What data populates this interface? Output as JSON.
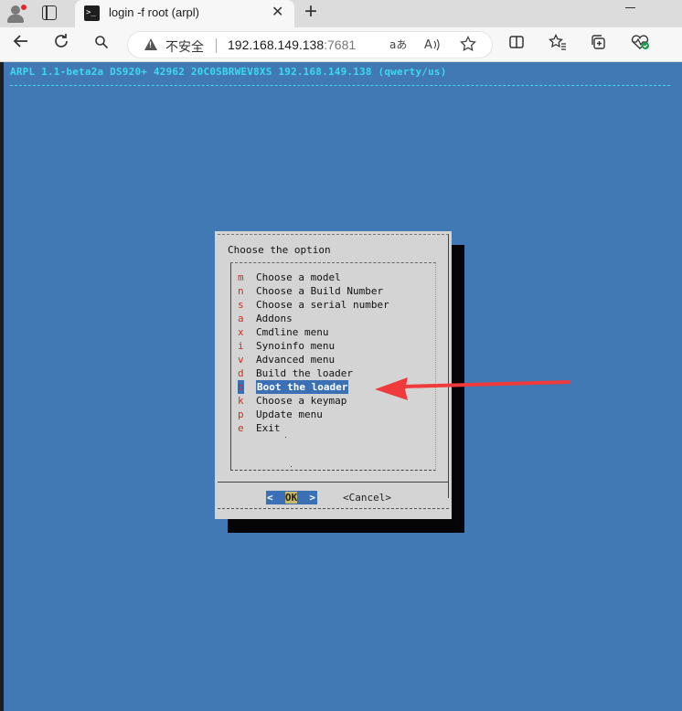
{
  "browser": {
    "tab_title": "login -f root (arpl)",
    "tab_icon_glyph": ">_",
    "close_glyph": "✕",
    "new_tab_glyph": "+",
    "address": {
      "security_label": "不安全",
      "host": "192.168.149.138",
      "port": ":7681"
    },
    "icons": [
      "profile-icon",
      "tab-actions-icon",
      "back-icon",
      "reload-icon",
      "search-icon",
      "read-aloud-icon",
      "text-size-icon",
      "favorite-icon",
      "split-screen-icon",
      "favorites-icon",
      "collections-icon",
      "performance-icon"
    ]
  },
  "terminal": {
    "backtitle": "ARPL 1.1-beta2a DS920+ 42962 20C0SBRWEV8XS 192.168.149.138 (qwerty/us)",
    "dialog": {
      "prompt": "Choose the option",
      "items": [
        {
          "key": "m",
          "label": "Choose a model"
        },
        {
          "key": "n",
          "label": "Choose a Build Number"
        },
        {
          "key": "s",
          "label": "Choose a serial number"
        },
        {
          "key": "a",
          "label": "Addons"
        },
        {
          "key": "x",
          "label": "Cmdline menu"
        },
        {
          "key": "i",
          "label": "Synoinfo menu"
        },
        {
          "key": "v",
          "label": "Advanced menu"
        },
        {
          "key": "d",
          "label": "Build the loader"
        },
        {
          "key": "b",
          "label": "Boot the loader",
          "selected": true
        },
        {
          "key": "k",
          "label": "Choose a keymap"
        },
        {
          "key": "p",
          "label": "Update menu"
        },
        {
          "key": "e",
          "label": "Exit"
        }
      ],
      "ok_left": "<  ",
      "ok_label": "OK",
      "ok_right": "  >",
      "cancel_label": "<Cancel>"
    }
  },
  "colors": {
    "terminal_bg": "#4179b4",
    "backtitle": "#3fd8f0",
    "dialog_bg": "#d4d4d4",
    "highlight": "#3c70b4",
    "hotkey": "#c8321d",
    "annotation_arrow": "#ef3b3b"
  }
}
